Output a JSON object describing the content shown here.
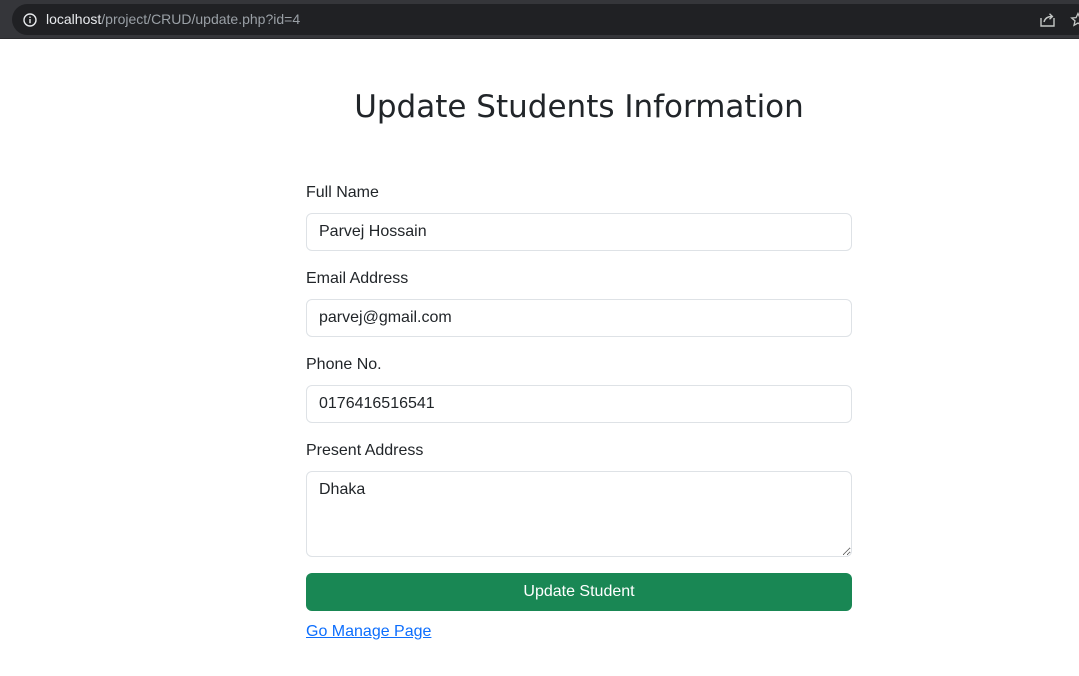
{
  "browser": {
    "url_host": "localhost",
    "url_path": "/project/CRUD/update.php?id=4"
  },
  "form": {
    "title": "Update Students Information",
    "full_name": {
      "label": "Full Name",
      "value": "Parvej Hossain"
    },
    "email": {
      "label": "Email Address",
      "value": "parvej@gmail.com"
    },
    "phone": {
      "label": "Phone No.",
      "value": "0176416516541"
    },
    "address": {
      "label": "Present Address",
      "value": "Dhaka"
    },
    "submit_label": "Update Student",
    "manage_link": "Go Manage Page"
  },
  "colors": {
    "primary_button": "#198754",
    "link": "#0d6efd",
    "browser_bar": "#35363a"
  }
}
